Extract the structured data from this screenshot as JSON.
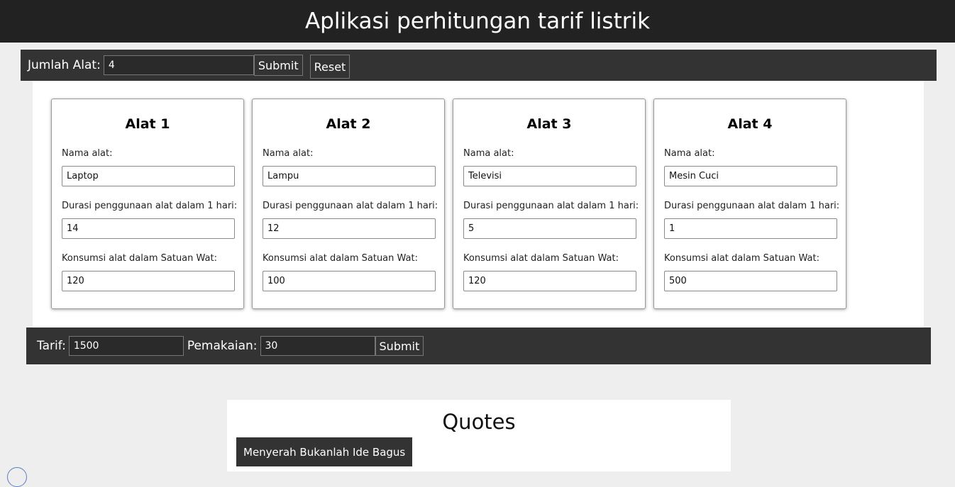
{
  "header": {
    "title": "Aplikasi perhitungan tarif listrik"
  },
  "jumlah": {
    "label": "Jumlah Alat:",
    "value": "4",
    "submit_label": "Submit",
    "reset_label": "Reset"
  },
  "devices": [
    {
      "title": "Alat 1",
      "name_label": "Nama alat:",
      "name_value": "Laptop",
      "duration_label": "Durasi penggunaan alat dalam 1 hari:",
      "duration_value": "14",
      "consumption_label": "Konsumsi alat dalam Satuan Wat:",
      "consumption_value": "120"
    },
    {
      "title": "Alat 2",
      "name_label": "Nama alat:",
      "name_value": "Lampu",
      "duration_label": "Durasi penggunaan alat dalam 1 hari:",
      "duration_value": "12",
      "consumption_label": "Konsumsi alat dalam Satuan Wat:",
      "consumption_value": "100"
    },
    {
      "title": "Alat 3",
      "name_label": "Nama alat:",
      "name_value": "Televisi",
      "duration_label": "Durasi penggunaan alat dalam 1 hari:",
      "duration_value": "5",
      "consumption_label": "Konsumsi alat dalam Satuan Wat:",
      "consumption_value": "120"
    },
    {
      "title": "Alat 4",
      "name_label": "Nama alat:",
      "name_value": "Mesin Cuci",
      "duration_label": "Durasi penggunaan alat dalam 1 hari:",
      "duration_value": "1",
      "consumption_label": "Konsumsi alat dalam Satuan Wat:",
      "consumption_value": "500"
    }
  ],
  "tarif": {
    "label": "Tarif:",
    "value": "1500",
    "pemakaian_label": "Pemakaian:",
    "pemakaian_value": "30",
    "submit_label": "Submit"
  },
  "quotes": {
    "title": "Quotes",
    "text": "Menyerah Bukanlah Ide Bagus"
  }
}
